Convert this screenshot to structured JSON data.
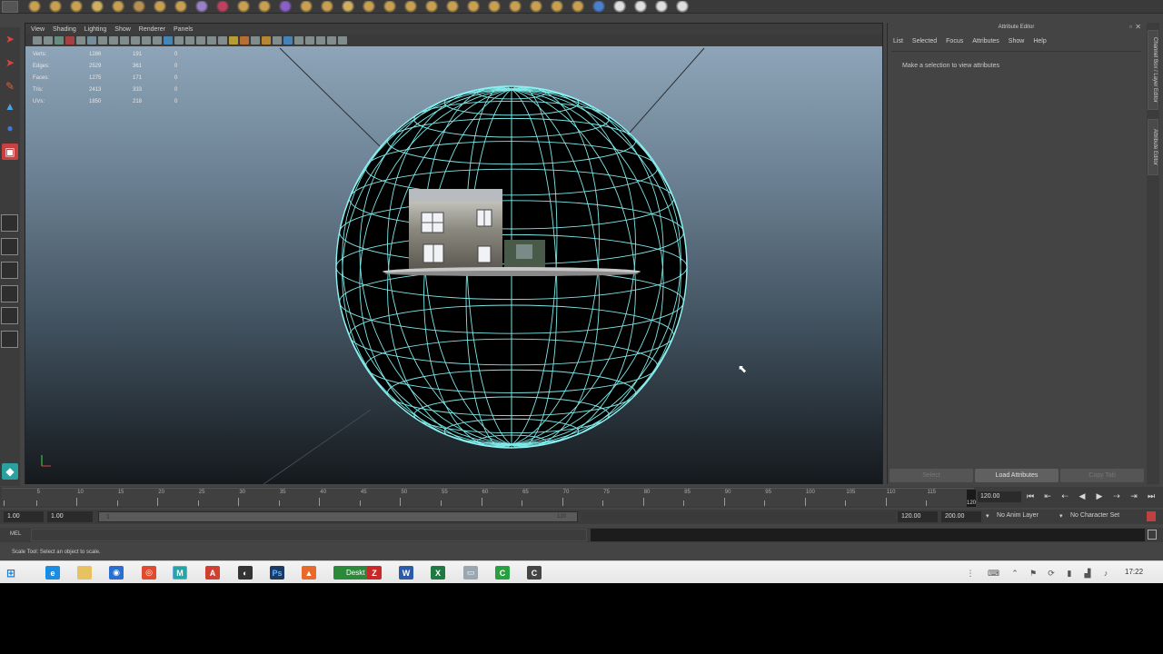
{
  "panel_menu": [
    "View",
    "Shading",
    "Lighting",
    "Show",
    "Renderer",
    "Panels"
  ],
  "hud": [
    {
      "label": "Verts:",
      "v1": "1286",
      "v2": "191",
      "v3": "0"
    },
    {
      "label": "Edges:",
      "v1": "2529",
      "v2": "361",
      "v3": "0"
    },
    {
      "label": "Faces:",
      "v1": "1275",
      "v2": "171",
      "v3": "0"
    },
    {
      "label": "Tris:",
      "v1": "2413",
      "v2": "333",
      "v3": "0"
    },
    {
      "label": "UVs:",
      "v1": "1850",
      "v2": "218",
      "v3": "0"
    }
  ],
  "attribute_editor": {
    "title": "Attribute Editor",
    "menu": [
      "List",
      "Selected",
      "Focus",
      "Attributes",
      "Show",
      "Help"
    ],
    "message": "Make a selection to view attributes",
    "buttons": {
      "select": "Select",
      "load": "Load Attributes",
      "copy": "Copy Tab"
    }
  },
  "side_tabs": {
    "channel_box": "Channel Box / Layer Editor",
    "attribute_editor": "Attribute Editor"
  },
  "timeslider": {
    "ticks": [
      "5",
      "10",
      "15",
      "20",
      "25",
      "30",
      "35",
      "40",
      "45",
      "50",
      "55",
      "60",
      "65",
      "70",
      "75",
      "80",
      "85",
      "90",
      "95",
      "100",
      "105",
      "110",
      "115"
    ],
    "current_frame": "120",
    "current_time_field": "120.00"
  },
  "rangeslider": {
    "start_time": "1.00",
    "playback_start": "1.00",
    "range_bar_start": "1",
    "range_bar_end": "120",
    "playback_end": "120.00",
    "end_time": "200.00",
    "anim_layer": "No Anim Layer",
    "character_set": "No Character Set"
  },
  "cmdline": {
    "label": "MEL"
  },
  "helpline": {
    "text": "Scale Tool: Select an object to scale."
  },
  "taskbar": {
    "clock": "17:22",
    "desktop_label": "Deskt"
  },
  "colors": {
    "wire": "#7fe8e8",
    "accent_cyan": "#26c6c6"
  }
}
